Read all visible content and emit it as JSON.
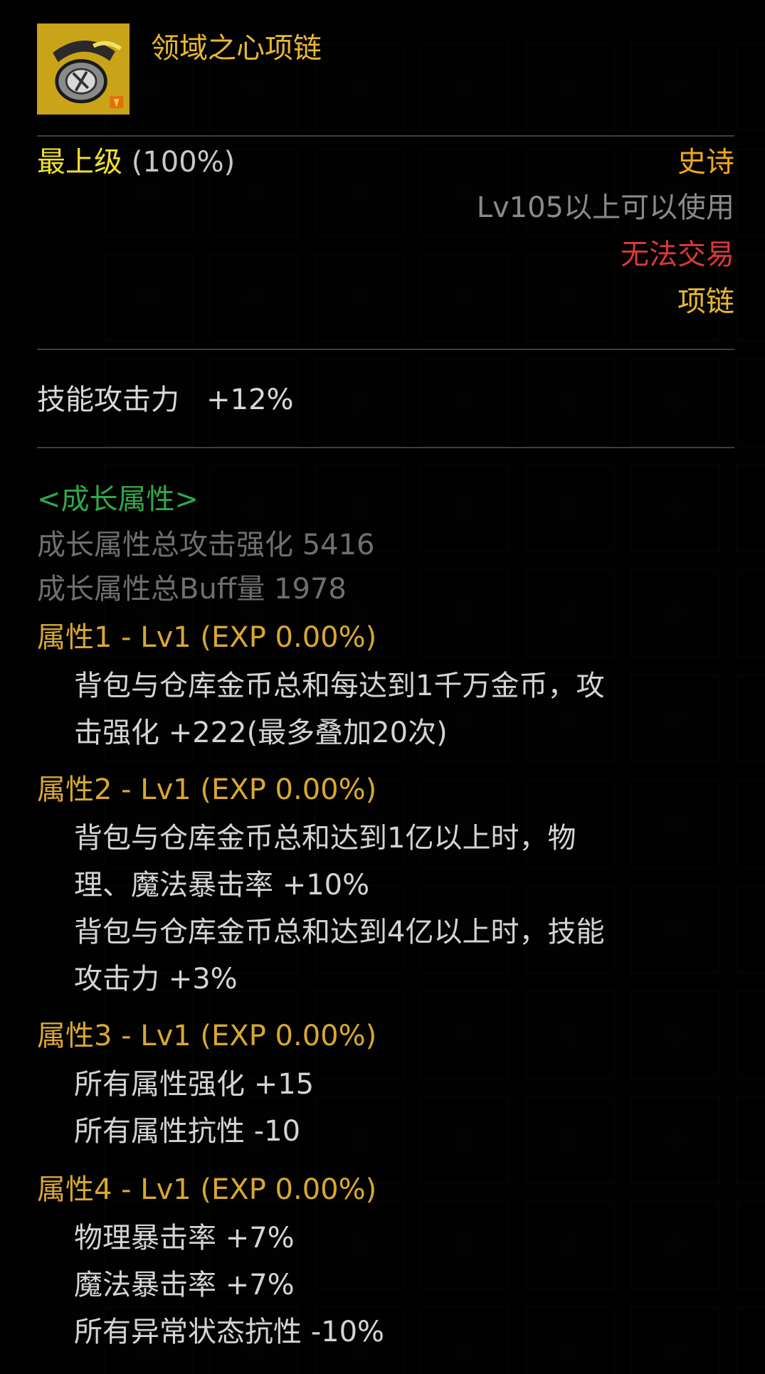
{
  "item": {
    "icon": "necklace-icon",
    "name": "领域之心项链",
    "grade": "最上级",
    "grade_percent": "(100%)",
    "rarity": "史诗",
    "level_requirement": "Lv105以上可以使用",
    "trade_status": "无法交易",
    "slot_type": "项链"
  },
  "base_stat": "技能攻击力   +12%",
  "growth": {
    "title": "<成长属性>",
    "total_attack": "成长属性总攻击强化 5416",
    "total_buff": "成长属性总Buff量 1978",
    "properties": [
      {
        "header": "属性1 - Lv1 (EXP 0.00%)",
        "lines": [
          "背包与仓库金币总和每达到1千万金币，攻",
          "击强化 +222(最多叠加20次)"
        ]
      },
      {
        "header": "属性2 - Lv1 (EXP 0.00%)",
        "lines": [
          "背包与仓库金币总和达到1亿以上时，物",
          "理、魔法暴击率 +10%",
          "背包与仓库金币总和达到4亿以上时，技能",
          "攻击力 +3%"
        ]
      },
      {
        "header": "属性3 - Lv1 (EXP 0.00%)",
        "lines": [
          "所有属性强化 +15",
          "所有属性抗性 -10"
        ]
      },
      {
        "header": "属性4 - Lv1 (EXP 0.00%)",
        "lines": [
          "物理暴击率 +7%",
          "魔法暴击率 +7%",
          "所有异常状态抗性 -10%"
        ]
      }
    ]
  },
  "colors": {
    "item_name": "#e8b830",
    "grade": "#f0e030",
    "rarity": "#f0a818",
    "untradeable": "#d83a3a",
    "growth_title": "#2fa84a",
    "property_header": "#d9a832"
  }
}
